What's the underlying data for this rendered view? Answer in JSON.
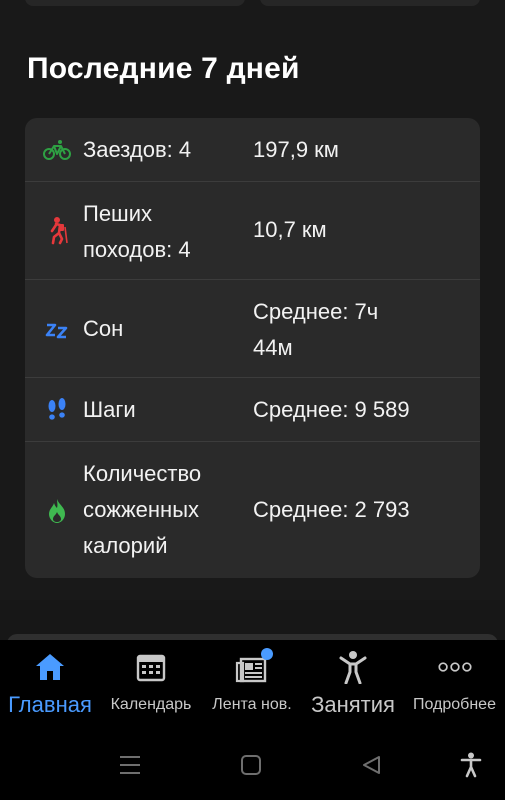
{
  "section": {
    "title": "Последние 7 дней"
  },
  "stats": [
    {
      "icon": "bike-icon",
      "label": "Заездов: 4",
      "value": "197,9 км",
      "color": "#2ea043"
    },
    {
      "icon": "hiker-icon",
      "label": "Пеших походов: 4",
      "value": "10,7 км",
      "color": "#e5383b"
    },
    {
      "icon": "sleep-icon",
      "label": "Сон",
      "value": "Среднее: 7ч 44м",
      "color": "#3b82f6"
    },
    {
      "icon": "footsteps-icon",
      "label": "Шаги",
      "value": "Среднее: 9 589",
      "color": "#3b82f6"
    },
    {
      "icon": "flame-icon",
      "label": "Количество сожженных калорий",
      "value": "Среднее: 2 793",
      "color": "#3fb950"
    }
  ],
  "tabs": [
    {
      "label": "Главная",
      "icon": "home-icon",
      "active": true
    },
    {
      "label": "Календарь",
      "icon": "calendar-icon",
      "active": false
    },
    {
      "label": "Лента нов.",
      "icon": "newsfeed-icon",
      "active": false,
      "badge": true
    },
    {
      "label": "Занятия",
      "icon": "activity-person-icon",
      "active": false
    },
    {
      "label": "Подробнее",
      "icon": "more-dots-icon",
      "active": false
    }
  ],
  "colors": {
    "accent": "#4a9bff",
    "background": "#191919",
    "card": "#2a2a2a"
  }
}
